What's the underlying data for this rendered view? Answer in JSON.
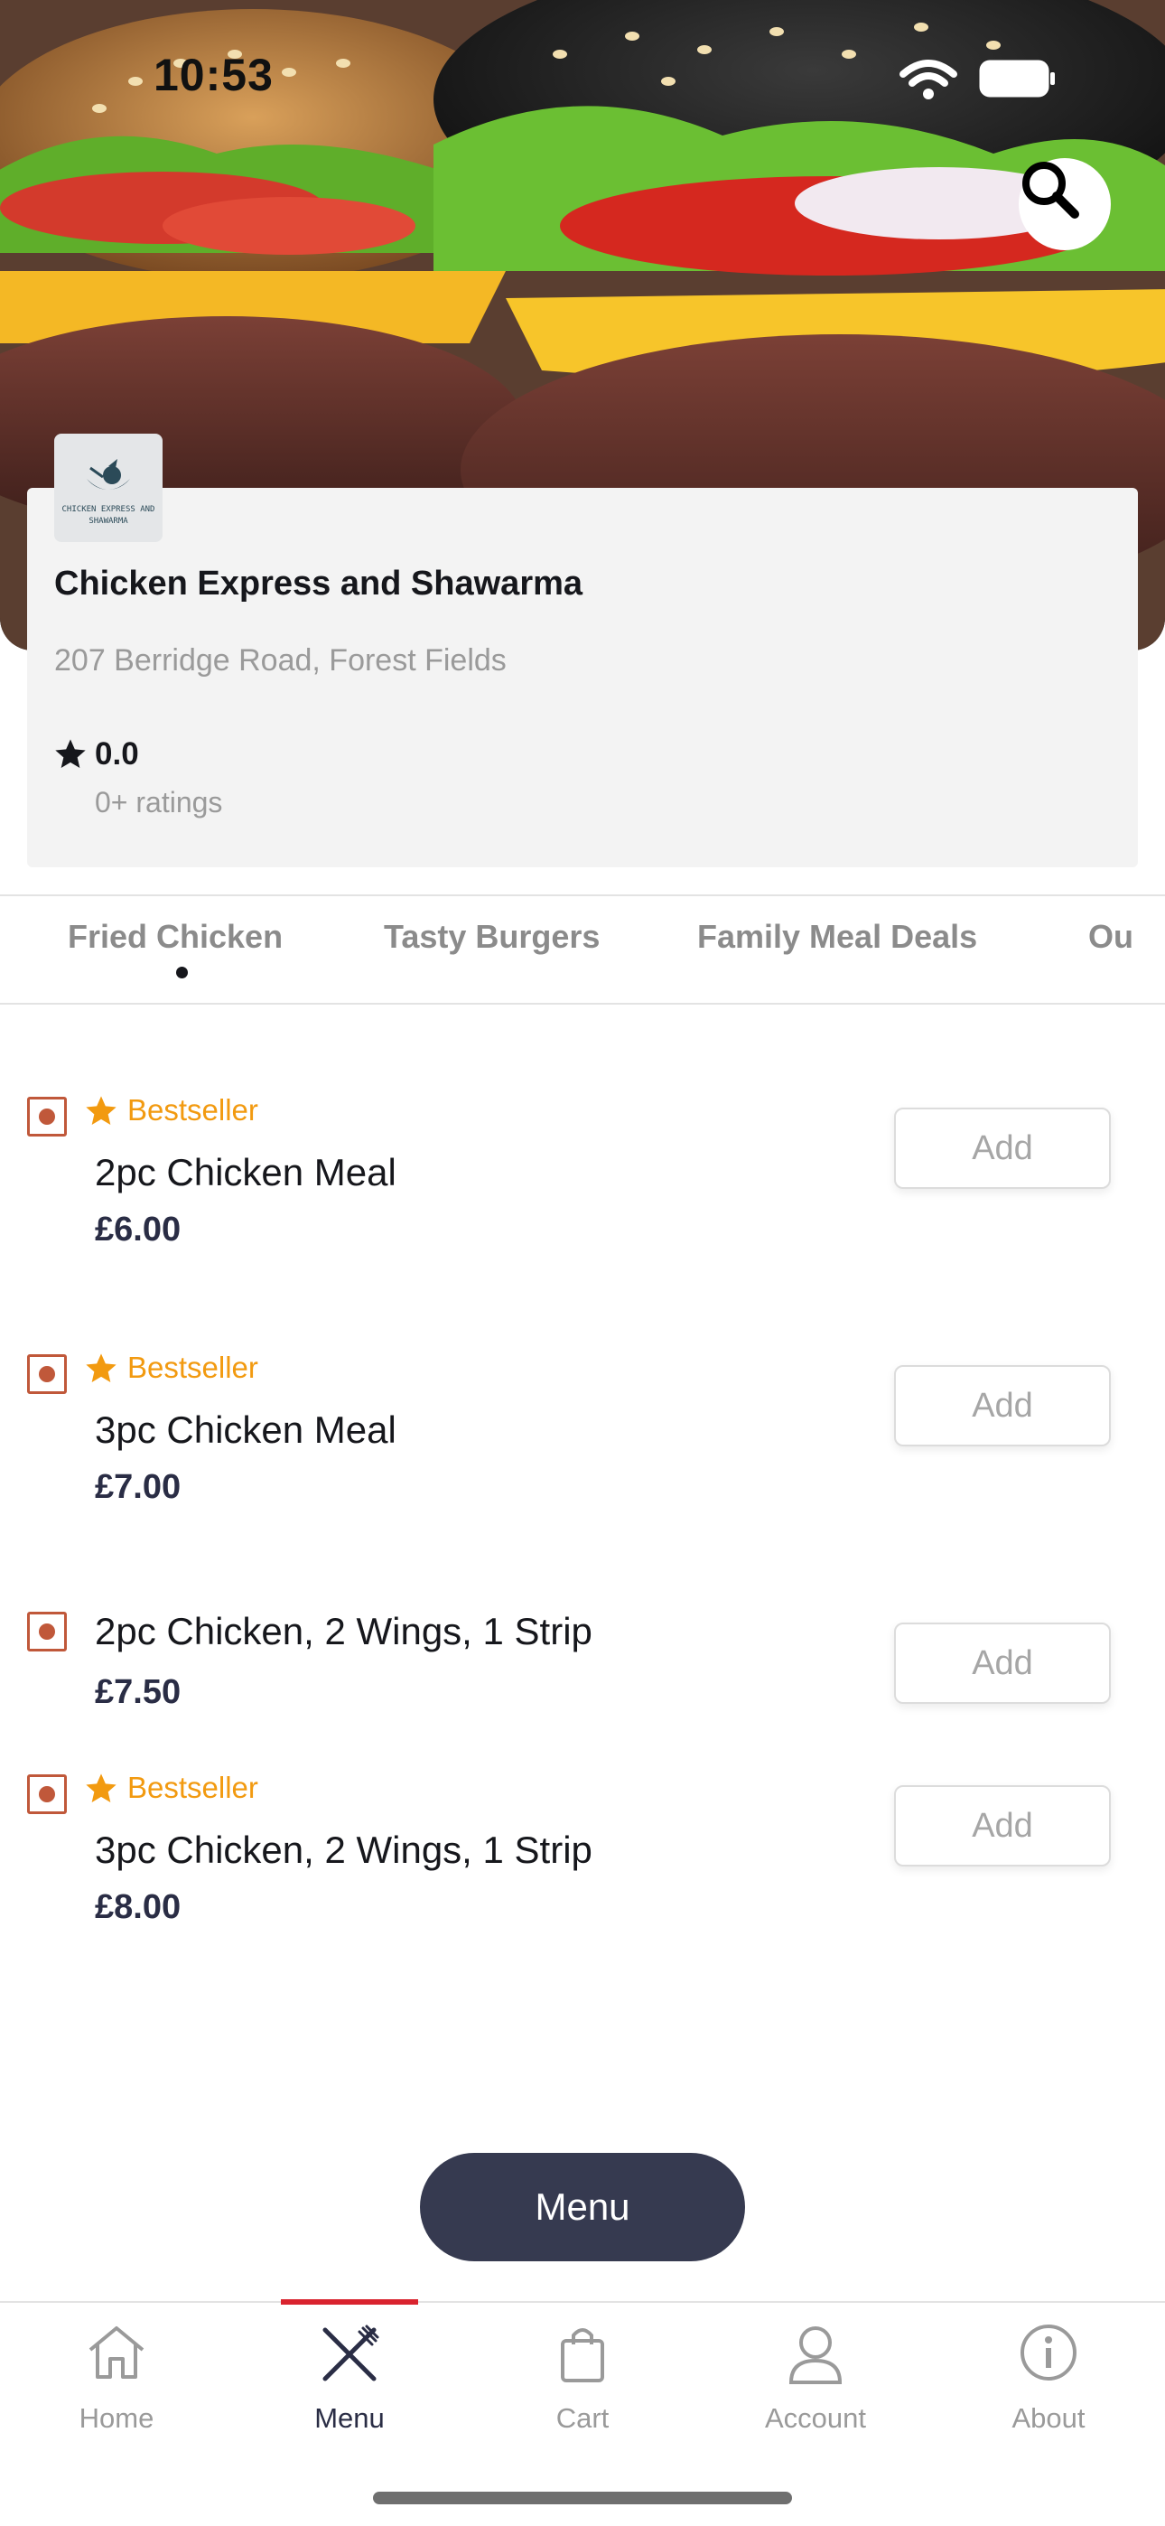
{
  "status_bar": {
    "time": "10:53"
  },
  "restaurant": {
    "logo_text": "CHICKEN EXPRESS AND SHAWARMA",
    "name": "Chicken Express and Shawarma",
    "address": "207 Berridge Road, Forest Fields",
    "rating": "0.0",
    "ratings_count": "0+ ratings"
  },
  "tabs": [
    {
      "label": "Fried Chicken",
      "active": true
    },
    {
      "label": "Tasty Burgers",
      "active": false
    },
    {
      "label": "Family Meal Deals",
      "active": false
    },
    {
      "label": "Ou",
      "active": false
    }
  ],
  "items": [
    {
      "badge": "Bestseller",
      "name": "2pc Chicken Meal",
      "price": "£6.00",
      "add_label": "Add"
    },
    {
      "badge": "Bestseller",
      "name": "3pc Chicken Meal",
      "price": "£7.00",
      "add_label": "Add"
    },
    {
      "badge": "",
      "name": "2pc Chicken, 2 Wings, 1 Strip",
      "price": "£7.50",
      "add_label": "Add"
    },
    {
      "badge": "Bestseller",
      "name": "3pc Chicken, 2 Wings, 1 Strip",
      "price": "£8.00",
      "add_label": "Add"
    }
  ],
  "menu_button": {
    "label": "Menu"
  },
  "bottom_nav": [
    {
      "label": "Home",
      "icon": "home-icon",
      "active": false
    },
    {
      "label": "Menu",
      "icon": "fork-knife-icon",
      "active": true
    },
    {
      "label": "Cart",
      "icon": "shopping-bag-icon",
      "active": false
    },
    {
      "label": "Account",
      "icon": "user-icon",
      "active": false
    },
    {
      "label": "About",
      "icon": "info-icon",
      "active": false
    }
  ],
  "colors": {
    "accent_red": "#d9232e",
    "bestseller_orange": "#f29a10",
    "veg_marker": "#c0583a",
    "menu_button_bg": "#363a50"
  }
}
